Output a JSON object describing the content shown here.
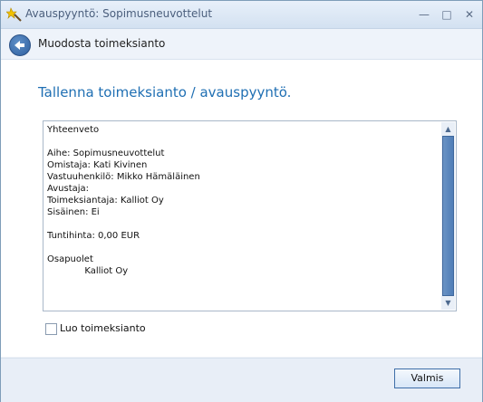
{
  "window": {
    "title": "Avauspyyntö: Sopimusneuvottelut"
  },
  "navbar": {
    "title": "Muodosta toimeksianto"
  },
  "main": {
    "heading": "Tallenna toimeksianto / avauspyyntö.",
    "summary_text": "Yhteenveto\n\nAihe: Sopimusneuvottelut\nOmistaja: Kati Kivinen\nVastuuhenkilö: Mikko Hämäläinen\nAvustaja:\nToimeksiantaja: Kalliot Oy\nSisäinen: Ei\n\nTuntihinta: 0,00 EUR\n\nOsapuolet\n             Kalliot Oy",
    "checkbox_label": "Luo toimeksianto"
  },
  "footer": {
    "done_label": "Valmis"
  }
}
